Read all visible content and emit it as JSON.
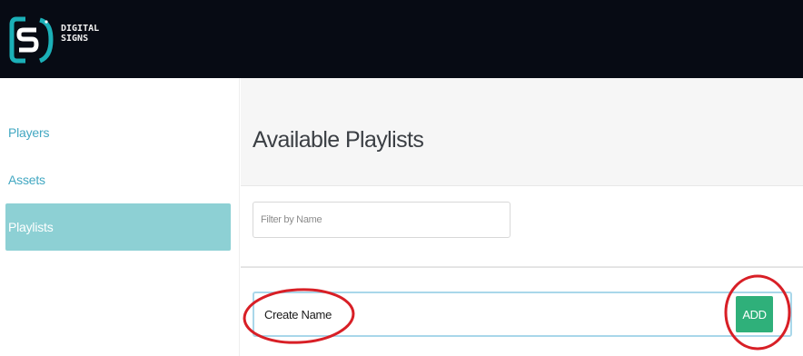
{
  "app": {
    "brand_line1": "DIGITAL",
    "brand_line2": "SIGNS"
  },
  "sidebar": {
    "items": [
      {
        "label": "Players",
        "active": false
      },
      {
        "label": "Assets",
        "active": false
      },
      {
        "label": "Playlists",
        "active": true
      }
    ]
  },
  "main": {
    "title": "Available Playlists",
    "filter": {
      "placeholder": "Filter by Name",
      "value": ""
    },
    "create": {
      "value": "Create Name",
      "add_label": "ADD"
    }
  },
  "colors": {
    "topbar": "#070b14",
    "accent": "#43a8c2",
    "active_nav": "#8dd0d4",
    "add_button": "#2fb07a",
    "annotation": "#d81f26"
  }
}
